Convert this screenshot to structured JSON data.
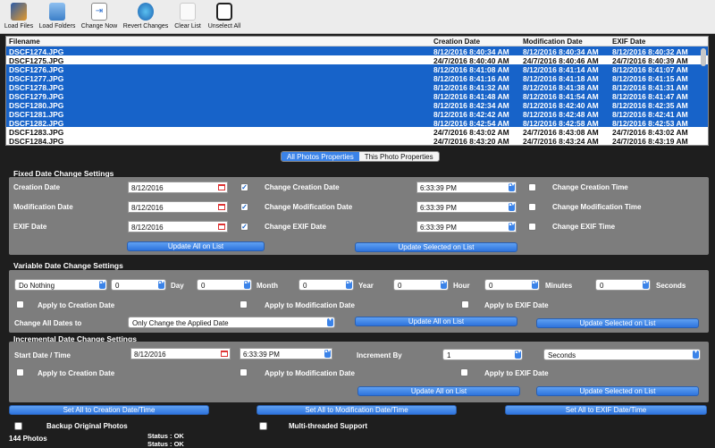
{
  "toolbar": {
    "items": [
      "Load Files",
      "Load Folders",
      "Change Now",
      "Revert Changes",
      "Clear List",
      "Unselect All"
    ]
  },
  "table": {
    "headers": [
      "Filename",
      "Creation Date",
      "Modification Date",
      "EXIF Date"
    ],
    "rows": [
      {
        "file": "DSCF1274.JPG",
        "created": "8/12/2016 8:40:34 AM",
        "modified": "8/12/2016 8:40:34 AM",
        "exif": "8/12/2016 8:40:32 AM",
        "selected": true
      },
      {
        "file": "DSCF1275.JPG",
        "created": "24/7/2016 8:40:40 AM",
        "modified": "24/7/2016 8:40:46 AM",
        "exif": "24/7/2016 8:40:39 AM",
        "selected": false
      },
      {
        "file": "DSCF1276.JPG",
        "created": "8/12/2016 8:41:08 AM",
        "modified": "8/12/2016 8:41:14 AM",
        "exif": "8/12/2016 8:41:07 AM",
        "selected": true
      },
      {
        "file": "DSCF1277.JPG",
        "created": "8/12/2016 8:41:16 AM",
        "modified": "8/12/2016 8:41:18 AM",
        "exif": "8/12/2016 8:41:15 AM",
        "selected": true
      },
      {
        "file": "DSCF1278.JPG",
        "created": "8/12/2016 8:41:32 AM",
        "modified": "8/12/2016 8:41:38 AM",
        "exif": "8/12/2016 8:41:31 AM",
        "selected": true
      },
      {
        "file": "DSCF1279.JPG",
        "created": "8/12/2016 8:41:48 AM",
        "modified": "8/12/2016 8:41:54 AM",
        "exif": "8/12/2016 8:41:47 AM",
        "selected": true
      },
      {
        "file": "DSCF1280.JPG",
        "created": "8/12/2016 8:42:34 AM",
        "modified": "8/12/2016 8:42:40 AM",
        "exif": "8/12/2016 8:42:35 AM",
        "selected": true
      },
      {
        "file": "DSCF1281.JPG",
        "created": "8/12/2016 8:42:42 AM",
        "modified": "8/12/2016 8:42:48 AM",
        "exif": "8/12/2016 8:42:41 AM",
        "selected": true
      },
      {
        "file": "DSCF1282.JPG",
        "created": "8/12/2016 8:42:54 AM",
        "modified": "8/12/2016 8:42:58 AM",
        "exif": "8/12/2016 8:42:53 AM",
        "selected": true
      },
      {
        "file": "DSCF1283.JPG",
        "created": "24/7/2016 8:43:02 AM",
        "modified": "24/7/2016 8:43:08 AM",
        "exif": "24/7/2016 8:43:02 AM",
        "selected": false
      },
      {
        "file": "DSCF1284.JPG",
        "created": "24/7/2016 8:43:20 AM",
        "modified": "24/7/2016 8:43:24 AM",
        "exif": "24/7/2016 8:43:19 AM",
        "selected": false
      }
    ]
  },
  "tabs": {
    "all": "All Photos Properties",
    "this": "This Photo Properties"
  },
  "fixed": {
    "title": "Fixed Date Change Settings",
    "creation_label": "Creation Date",
    "creation_date": "8/12/2016",
    "change_creation": "Change Creation Date",
    "creation_time": "6:33:39 PM",
    "change_creation_time": "Change Creation Time",
    "mod_label": "Modification Date",
    "mod_date": "8/12/2016",
    "change_mod": "Change Modification Date",
    "mod_time": "6:33:39 PM",
    "change_mod_time": "Change Modification Time",
    "exif_label": "EXIF Date",
    "exif_date": "8/12/2016",
    "change_exif": "Change EXIF Date",
    "exif_time": "6:33:39 PM",
    "change_exif_time": "Change EXIF Time",
    "update_all": "Update All on List",
    "update_selected": "Update Selected on List"
  },
  "variable": {
    "title": "Variable Date Change Settings",
    "mode": "Do Nothing",
    "day_val": "0",
    "day": "Day",
    "month_val": "0",
    "month": "Month",
    "year_val": "0",
    "year": "Year",
    "hour_val": "0",
    "hour": "Hour",
    "min_val": "0",
    "minutes": "Minutes",
    "sec_val": "0",
    "seconds": "Seconds",
    "apply_creation": "Apply to Creation Date",
    "apply_mod": "Apply to Modification Date",
    "apply_exif": "Apply to EXIF Date",
    "change_all_label": "Change All Dates to",
    "change_all_value": "Only Change the Applied Date",
    "update_all": "Update All on List",
    "update_selected": "Update Selected on List"
  },
  "incremental": {
    "title": "Incremental Date Change Settings",
    "start_label": "Start Date / Time",
    "start_date": "8/12/2016",
    "start_time": "6:33:39 PM",
    "increment_label": "Increment By",
    "increment_val": "1",
    "unit": "Seconds",
    "apply_creation": "Apply to Creation Date",
    "apply_mod": "Apply to Modification Date",
    "apply_exif": "Apply to EXIF Date",
    "update_all": "Update All on List",
    "update_selected": "Update Selected on List"
  },
  "bottom": {
    "set_creation": "Set All to Creation Date/Time",
    "set_mod": "Set All to Modification Date/Time",
    "set_exif": "Set All to EXIF Date/Time",
    "backup": "Backup Original Photos",
    "multithread": "Multi-threaded Support",
    "count": "144 Photos",
    "status1": "Status : OK",
    "status2": "Status : OK"
  }
}
